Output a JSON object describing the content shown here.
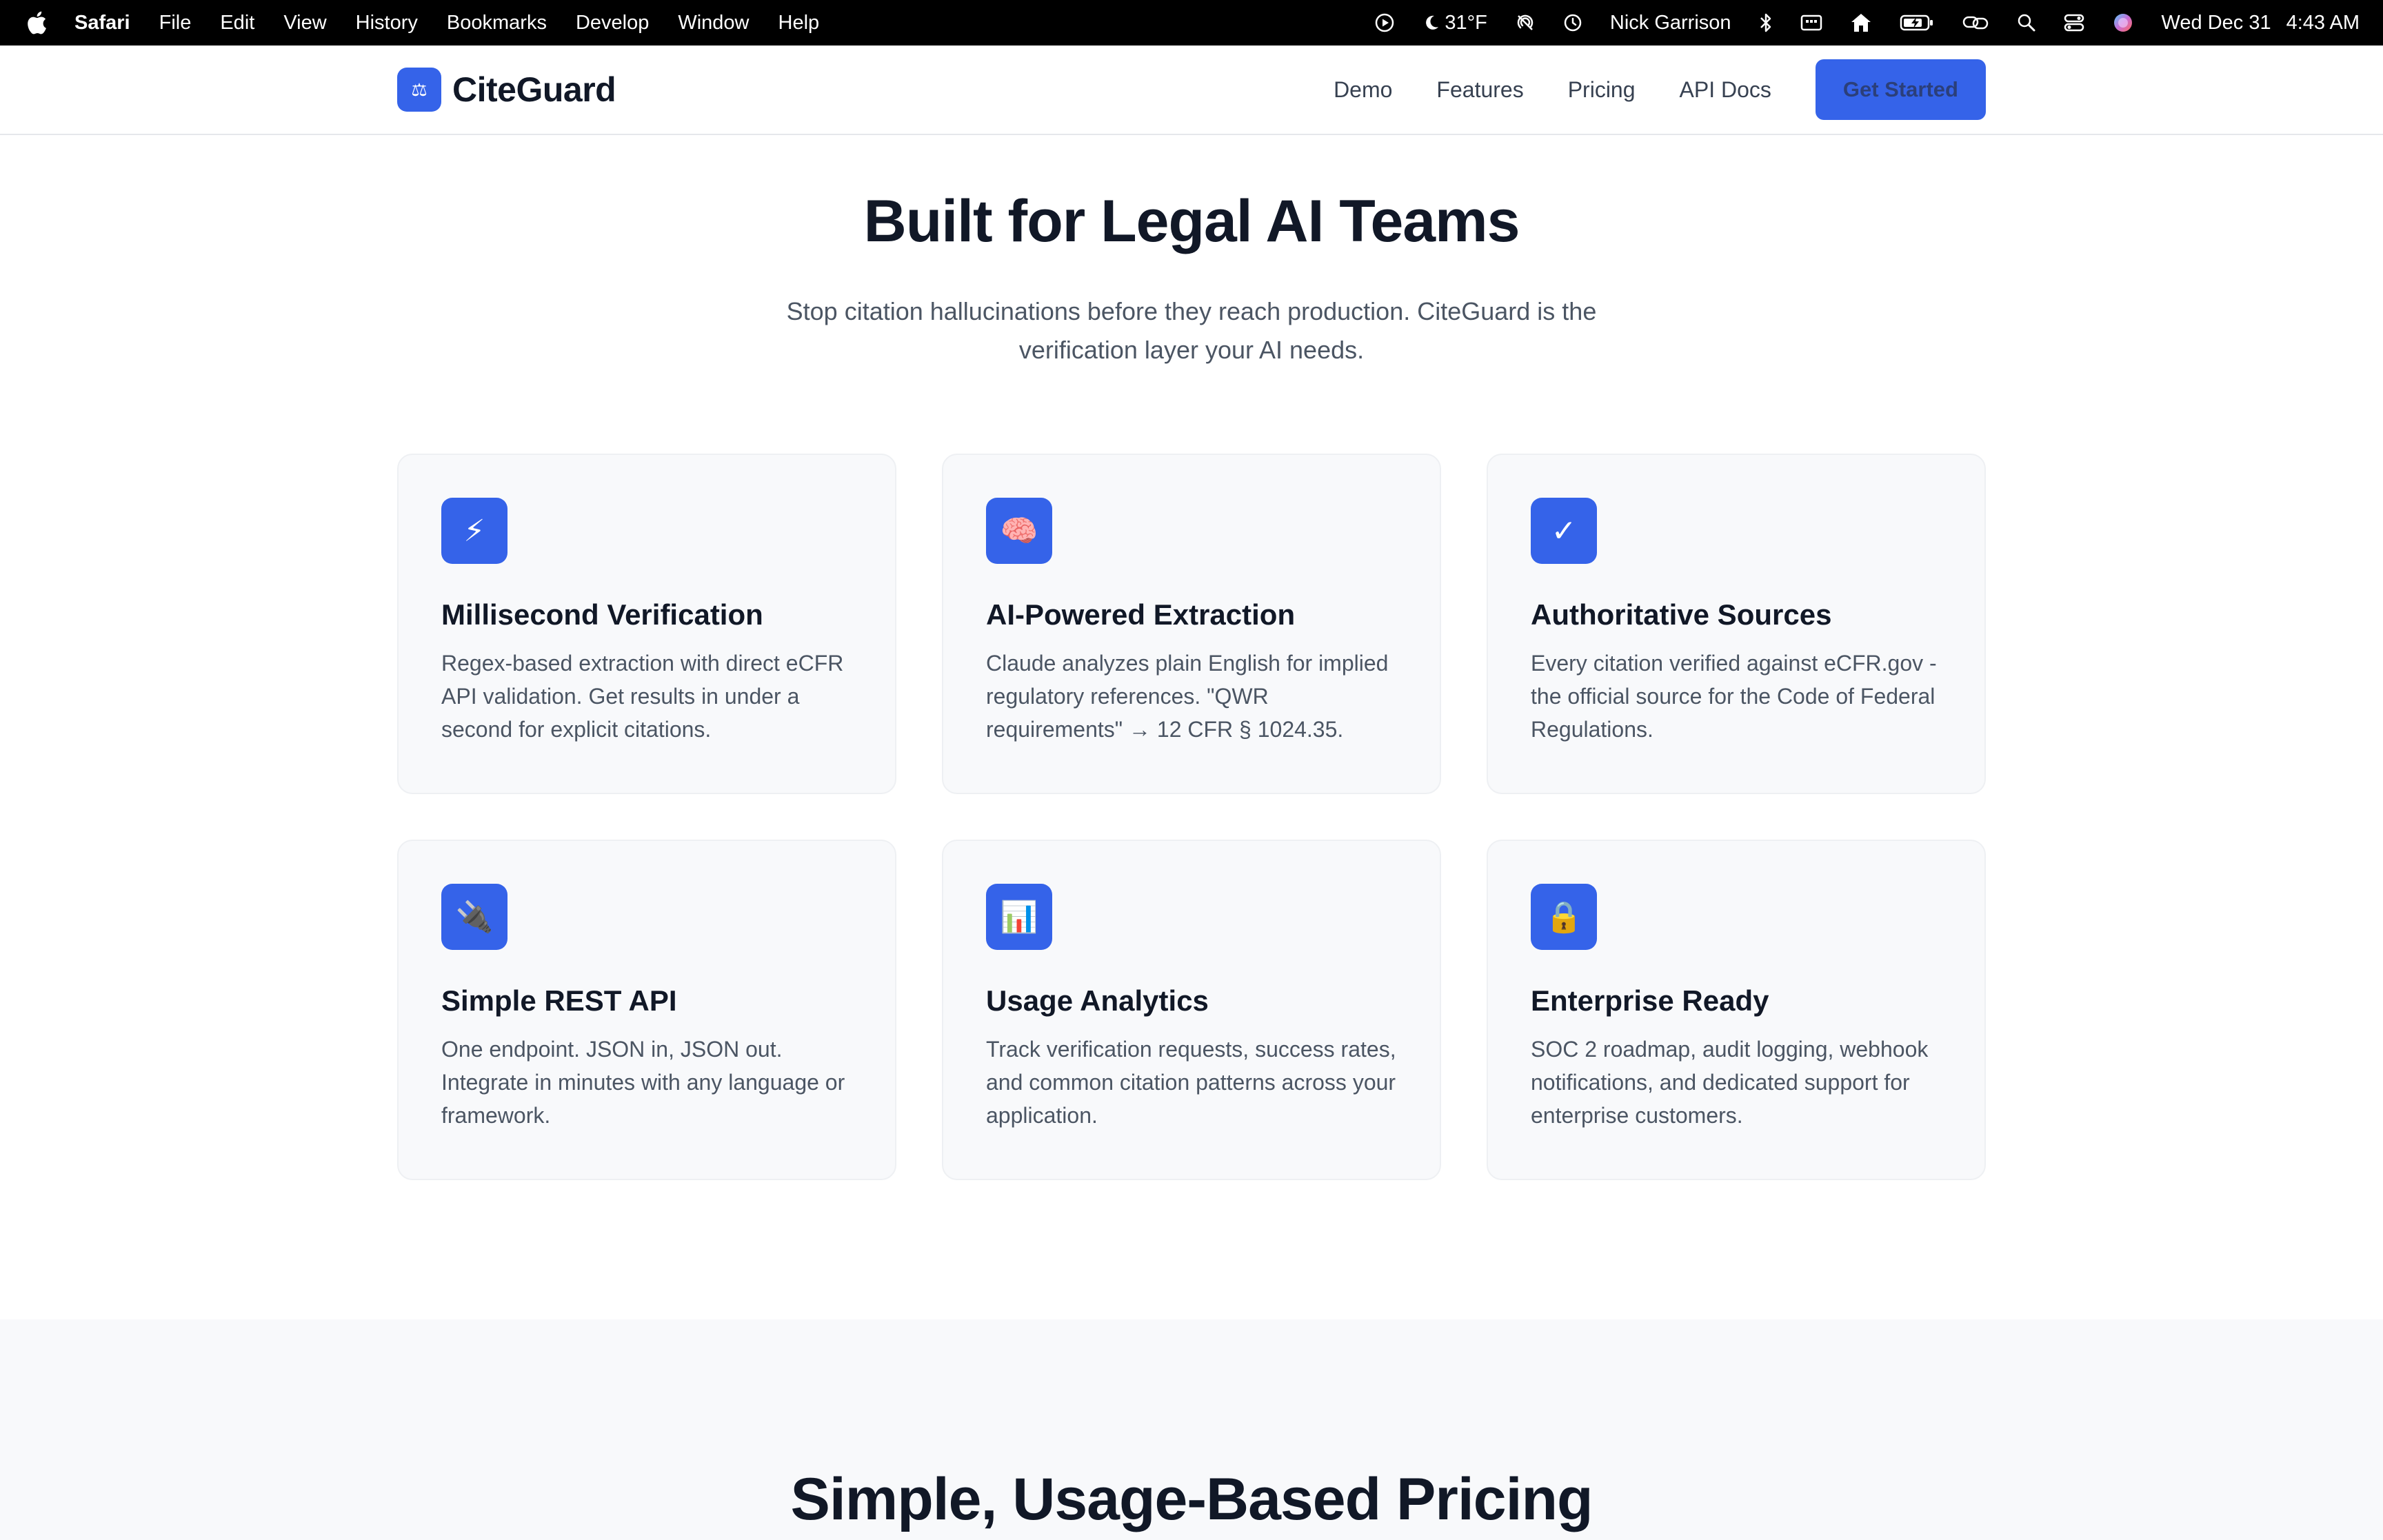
{
  "menubar": {
    "app_name": "Safari",
    "menus": [
      "File",
      "Edit",
      "View",
      "History",
      "Bookmarks",
      "Develop",
      "Window",
      "Help"
    ],
    "weather": "31°F",
    "user": "Nick Garrison",
    "date": "Wed Dec 31",
    "time": "4:43 AM"
  },
  "header": {
    "logo_text": "CiteGuard",
    "logo_glyph": "⚖",
    "nav": [
      "Demo",
      "Features",
      "Pricing",
      "API Docs"
    ],
    "cta_label": "Get Started"
  },
  "features": {
    "title": "Built for Legal AI Teams",
    "subtitle": "Stop citation hallucinations before they reach production. CiteGuard is the verification layer your AI needs.",
    "cards": [
      {
        "icon": "lightning-icon",
        "glyph": "⚡",
        "title": "Millisecond Verification",
        "description": "Regex-based extraction with direct eCFR API validation. Get results in under a second for explicit citations."
      },
      {
        "icon": "brain-icon",
        "glyph": "🧠",
        "title": "AI-Powered Extraction",
        "description": "Claude analyzes plain English for implied regulatory references. \"QWR requirements\" → 12 CFR § 1024.35."
      },
      {
        "icon": "checkmark-icon",
        "glyph": "✓",
        "title": "Authoritative Sources",
        "description": "Every citation verified against eCFR.gov - the official source for the Code of Federal Regulations."
      },
      {
        "icon": "plug-icon",
        "glyph": "🔌",
        "title": "Simple REST API",
        "description": "One endpoint. JSON in, JSON out. Integrate in minutes with any language or framework."
      },
      {
        "icon": "bar-chart-icon",
        "glyph": "📊",
        "title": "Usage Analytics",
        "description": "Track verification requests, success rates, and common citation patterns across your application."
      },
      {
        "icon": "lock-icon",
        "glyph": "🔒",
        "title": "Enterprise Ready",
        "description": "SOC 2 roadmap, audit logging, webhook notifications, and dedicated support for enterprise customers."
      }
    ]
  },
  "pricing": {
    "title": "Simple, Usage-Based Pricing"
  },
  "colors": {
    "accent": "#3563e9",
    "card_bg": "#f8f9fb",
    "heading": "#111827",
    "body_text": "#4b5563"
  }
}
